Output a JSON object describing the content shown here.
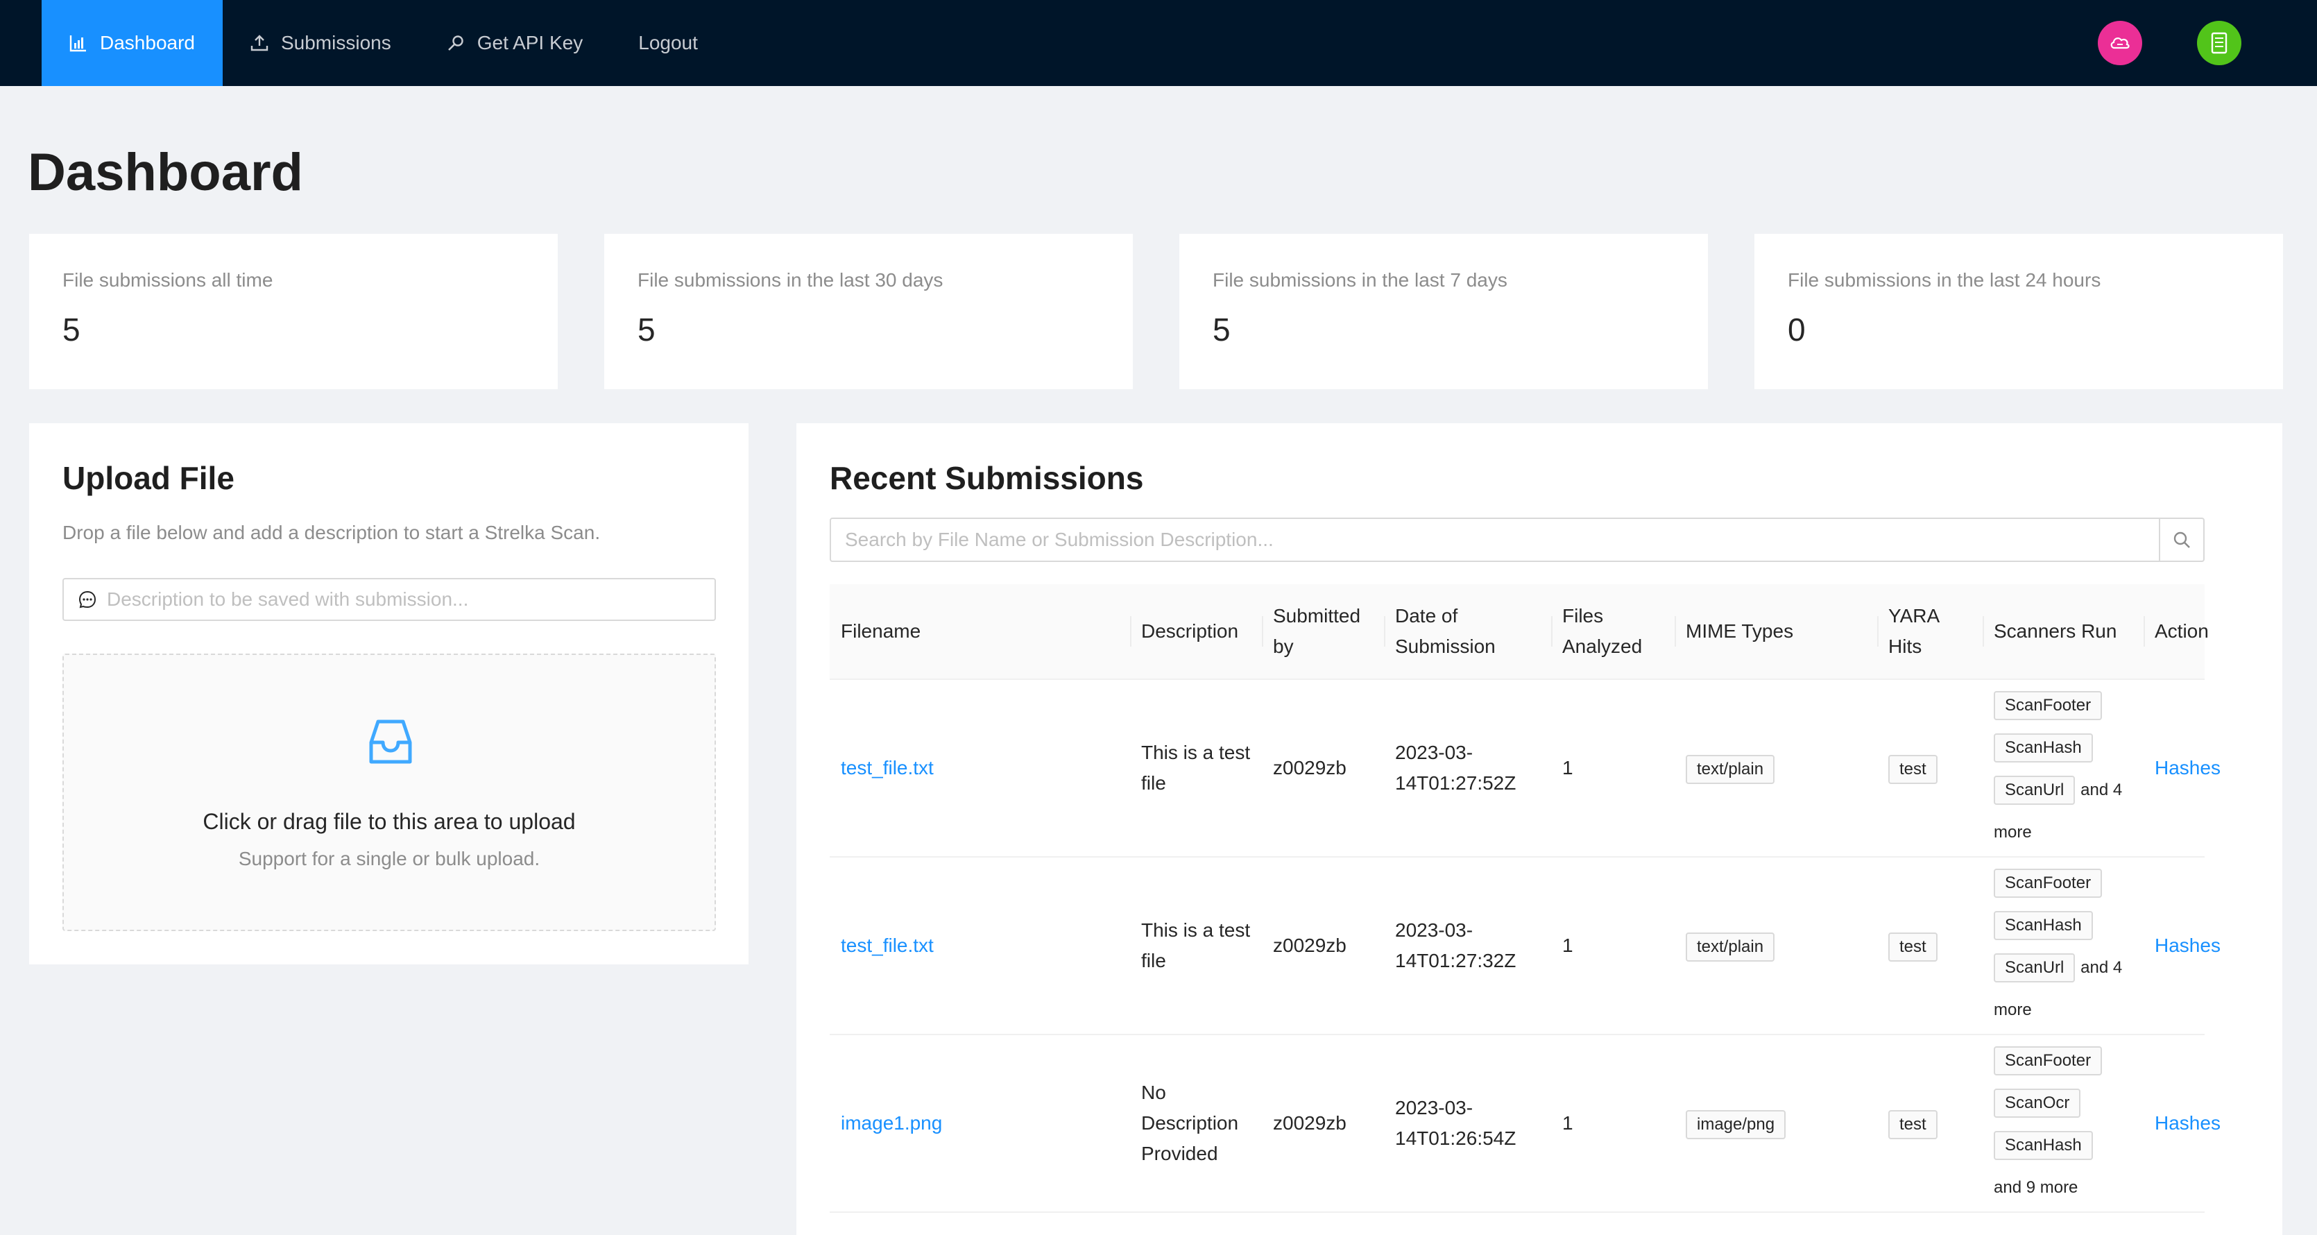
{
  "nav": {
    "items": [
      {
        "label": "Dashboard",
        "icon": "bar-chart-icon",
        "active": true
      },
      {
        "label": "Submissions",
        "icon": "upload-icon"
      },
      {
        "label": "Get API Key",
        "icon": "key-icon"
      },
      {
        "label": "Logout"
      }
    ],
    "avatars": [
      {
        "icon": "cloud-icon",
        "color": "#eb2f96"
      },
      {
        "icon": "document-icon",
        "color": "#52c41a"
      }
    ]
  },
  "page": {
    "title": "Dashboard"
  },
  "stats": [
    {
      "label": "File submissions all time",
      "value": "5"
    },
    {
      "label": "File submissions in the last 30 days",
      "value": "5"
    },
    {
      "label": "File submissions in the last 7 days",
      "value": "5"
    },
    {
      "label": "File submissions in the last 24 hours",
      "value": "0"
    }
  ],
  "upload": {
    "title": "Upload File",
    "description": "Drop a file below and add a description to start a Strelka Scan.",
    "input_placeholder": "Description to be saved with submission...",
    "drop_text": "Click or drag file to this area to upload",
    "drop_hint": "Support for a single or bulk upload."
  },
  "recent": {
    "title": "Recent Submissions",
    "search_placeholder": "Search by File Name or Submission Description...",
    "columns": [
      "Filename",
      "Description",
      "Submitted by",
      "Date of Submission",
      "Files Analyzed",
      "MIME Types",
      "YARA Hits",
      "Scanners Run",
      "Action"
    ],
    "rows": [
      {
        "filename": "test_file.txt",
        "description": "This is a test file",
        "submitted_by": "z0029zb",
        "date": "2023-03-14T01:27:52Z",
        "files": "1",
        "mime": "text/plain",
        "yara": "test",
        "scanners": [
          "ScanFooter",
          "ScanHash",
          "ScanUrl"
        ],
        "more": "and 4 more",
        "action": "Hashes"
      },
      {
        "filename": "test_file.txt",
        "description": "This is a test file",
        "submitted_by": "z0029zb",
        "date": "2023-03-14T01:27:32Z",
        "files": "1",
        "mime": "text/plain",
        "yara": "test",
        "scanners": [
          "ScanFooter",
          "ScanHash",
          "ScanUrl"
        ],
        "more": "and 4 more",
        "action": "Hashes"
      },
      {
        "filename": "image1.png",
        "description": "No Description Provided",
        "submitted_by": "z0029zb",
        "date": "2023-03-14T01:26:54Z",
        "files": "1",
        "mime": "image/png",
        "yara": "test",
        "scanners": [
          "ScanFooter",
          "ScanOcr",
          "ScanHash"
        ],
        "more": "and 9 more",
        "action": "Hashes"
      }
    ]
  },
  "colors": {
    "nav_bg": "#001529",
    "accent": "#1890ff",
    "page_bg": "#f0f2f5"
  }
}
